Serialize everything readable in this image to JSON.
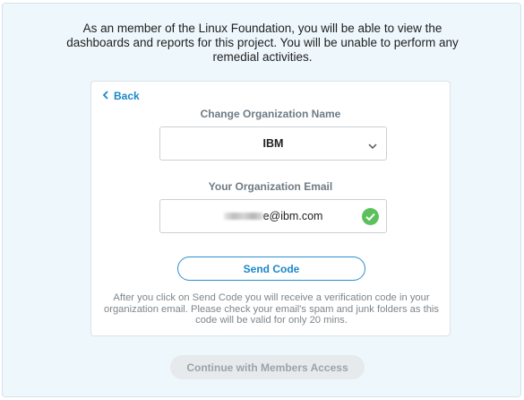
{
  "intro_text": "As an member of the Linux Foundation, you will be able to view the dashboards and reports for this project. You will be unable to perform any remedial activities.",
  "back_label": "Back",
  "org_name": {
    "label": "Change Organization Name",
    "selected": "IBM"
  },
  "org_email": {
    "label": "Your Organization Email",
    "value_visible": "e@ibm.com"
  },
  "send_code_label": "Send Code",
  "help_text": "After you click on Send Code you will receive a verification code in your organization email. Please check your email's spam and junk folders as this code will be valid for only 20 mins.",
  "continue_label": "Continue with Members Access",
  "colors": {
    "accent": "#1a87c9",
    "success": "#5cc05c",
    "panel_bg": "#eef7fc"
  },
  "icons": {
    "back": "chevron-left-icon",
    "dropdown": "chevron-down-icon",
    "valid": "check-circle-icon"
  }
}
